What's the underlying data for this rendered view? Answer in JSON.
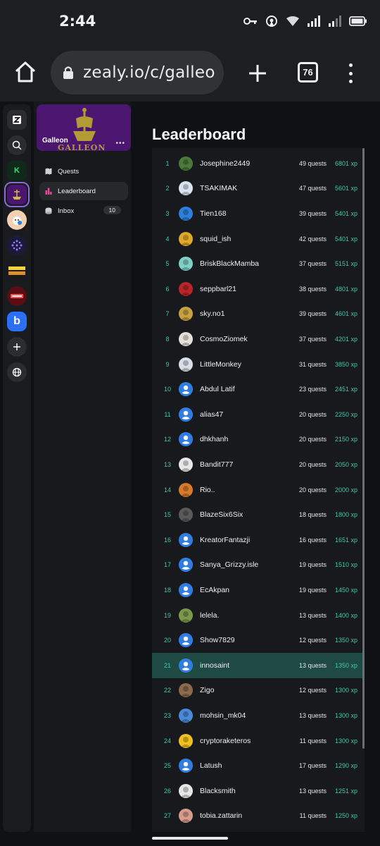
{
  "status_bar": {
    "time": "2:44"
  },
  "browser": {
    "url": "zealy.io/c/galleo",
    "tab_count": "76"
  },
  "rail": {
    "items": [
      {
        "name": "zealy-logo",
        "label": "Z",
        "bg": "#2a2c30",
        "fg": "#ffffff"
      },
      {
        "name": "search",
        "label": "",
        "bg": "#2a2c30",
        "fg": "#ffffff"
      },
      {
        "name": "community-k",
        "label": "K",
        "bg": "#0f2a1a",
        "fg": "#31e07a"
      },
      {
        "name": "community-galleon",
        "label": "",
        "bg": "#4a1670",
        "fg": "#d8b54a"
      },
      {
        "name": "community-cat",
        "label": "",
        "bg": "#f2d0b0",
        "fg": "#333"
      },
      {
        "name": "community-dots",
        "label": "",
        "bg": "#1a1a3a",
        "fg": "#9a7cff"
      },
      {
        "name": "community-neon",
        "label": "",
        "bg": "#1a1a1a",
        "fg": "#f2d33a"
      },
      {
        "name": "community-red",
        "label": "",
        "bg": "#5a0d14",
        "fg": "#ff5050"
      },
      {
        "name": "community-b",
        "label": "b",
        "bg": "#2b6ff2",
        "fg": "#ffffff"
      },
      {
        "name": "add-community",
        "label": "+",
        "bg": "#2a2c30",
        "fg": "#ffffff"
      },
      {
        "name": "explore",
        "label": "",
        "bg": "#2a2c30",
        "fg": "#ffffff"
      }
    ]
  },
  "sidebar": {
    "community_name": "Galleon",
    "banner_word": "GALLEON",
    "nav": [
      {
        "label": "Quests",
        "icon": "map-icon"
      },
      {
        "label": "Leaderboard",
        "icon": "bar-chart-icon"
      },
      {
        "label": "Inbox",
        "icon": "inbox-icon",
        "badge": "10"
      }
    ]
  },
  "leaderboard": {
    "title": "Leaderboard",
    "accent_color": "#3fc7a8",
    "highlight_color": "#1e4a43",
    "rows": [
      {
        "rank": "1",
        "name": "Josephine2449",
        "quests": "49 quests",
        "xp": "6801 xp",
        "avatar": "#4a7a3a"
      },
      {
        "rank": "2",
        "name": "TSAKIMAK",
        "quests": "47 quests",
        "xp": "5601 xp",
        "avatar": "#d8e4f0"
      },
      {
        "rank": "3",
        "name": "Tien168",
        "quests": "39 quests",
        "xp": "5401 xp",
        "avatar": "#2e7fd9"
      },
      {
        "rank": "4",
        "name": "squid_ish",
        "quests": "42 quests",
        "xp": "5401 xp",
        "avatar": "#e0a82a"
      },
      {
        "rank": "5",
        "name": "BriskBlackMamba",
        "quests": "37 quests",
        "xp": "5151 xp",
        "avatar": "#7fd0c8"
      },
      {
        "rank": "6",
        "name": "seppbarl21",
        "quests": "38 quests",
        "xp": "4801 xp",
        "avatar": "#b8242a"
      },
      {
        "rank": "7",
        "name": "sky.no1",
        "quests": "39 quests",
        "xp": "4601 xp",
        "avatar": "#c8a040"
      },
      {
        "rank": "8",
        "name": "CosmoZiomek",
        "quests": "37 quests",
        "xp": "4201 xp",
        "avatar": "#e8e0d8"
      },
      {
        "rank": "9",
        "name": "LittleMonkey",
        "quests": "31 quests",
        "xp": "3850 xp",
        "avatar": "#d8dfe8"
      },
      {
        "rank": "10",
        "name": "Abdul Latif",
        "quests": "23 quests",
        "xp": "2451 xp",
        "avatar": "default"
      },
      {
        "rank": "11",
        "name": "alias47",
        "quests": "20 quests",
        "xp": "2250 xp",
        "avatar": "default"
      },
      {
        "rank": "12",
        "name": "dhkhanh",
        "quests": "20 quests",
        "xp": "2150 xp",
        "avatar": "default"
      },
      {
        "rank": "13",
        "name": "Bandit777",
        "quests": "20 quests",
        "xp": "2050 xp",
        "avatar": "#e8e8e8"
      },
      {
        "rank": "14",
        "name": "Rio..",
        "quests": "20 quests",
        "xp": "2000 xp",
        "avatar": "#d87a2a"
      },
      {
        "rank": "15",
        "name": "BlazeSix6Six",
        "quests": "18 quests",
        "xp": "1800 xp",
        "avatar": "#5a5a5a"
      },
      {
        "rank": "16",
        "name": "KreatorFantazji",
        "quests": "16 quests",
        "xp": "1651 xp",
        "avatar": "default"
      },
      {
        "rank": "17",
        "name": "Sanya_Grizzy.isle",
        "quests": "19 quests",
        "xp": "1510 xp",
        "avatar": "default"
      },
      {
        "rank": "18",
        "name": "EcAkpan",
        "quests": "19 quests",
        "xp": "1450 xp",
        "avatar": "default"
      },
      {
        "rank": "19",
        "name": "lelela.",
        "quests": "13 quests",
        "xp": "1400 xp",
        "avatar": "#7a9a4a"
      },
      {
        "rank": "20",
        "name": "Show7829",
        "quests": "12 quests",
        "xp": "1350 xp",
        "avatar": "default"
      },
      {
        "rank": "21",
        "name": "innosaint",
        "quests": "13 quests",
        "xp": "1350 xp",
        "avatar": "default",
        "highlight": true
      },
      {
        "rank": "22",
        "name": "Zigo",
        "quests": "12 quests",
        "xp": "1300 xp",
        "avatar": "#8a6a4a"
      },
      {
        "rank": "23",
        "name": "mohsin_mk04",
        "quests": "13 quests",
        "xp": "1300 xp",
        "avatar": "#4a8ad8"
      },
      {
        "rank": "24",
        "name": "cryptoraketeros",
        "quests": "11 quests",
        "xp": "1300 xp",
        "avatar": "#f0c020"
      },
      {
        "rank": "25",
        "name": "Latush",
        "quests": "17 quests",
        "xp": "1290 xp",
        "avatar": "default"
      },
      {
        "rank": "26",
        "name": "Blacksmith",
        "quests": "13 quests",
        "xp": "1251 xp",
        "avatar": "#e8e8e8"
      },
      {
        "rank": "27",
        "name": "tobia.zattarin",
        "quests": "11 quests",
        "xp": "1250 xp",
        "avatar": "#d89a8a"
      }
    ]
  }
}
